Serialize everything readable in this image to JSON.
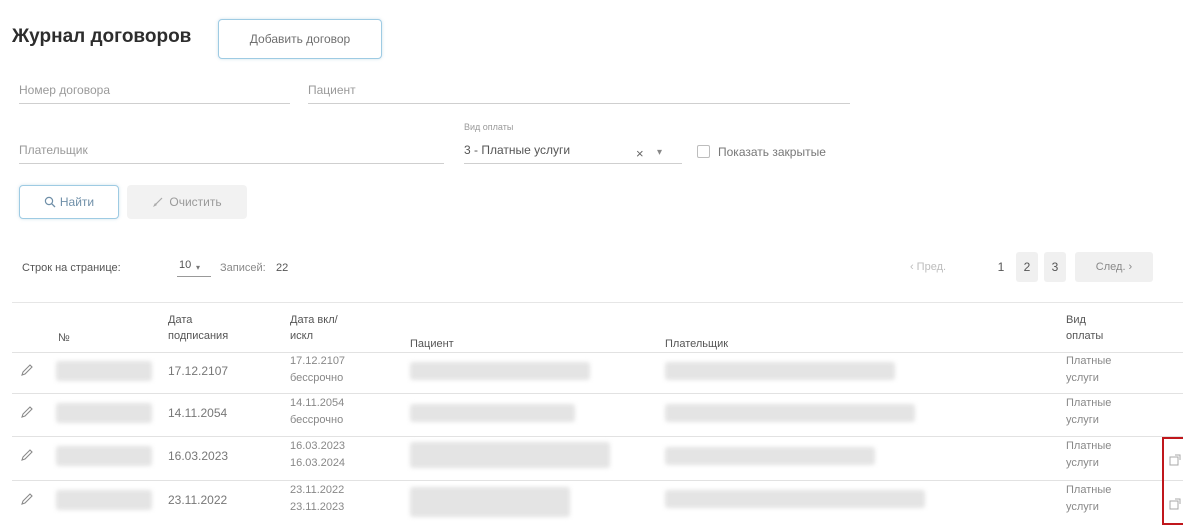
{
  "header": {
    "title": "Журнал договоров",
    "add_button_label": "Добавить договор"
  },
  "filters": {
    "contract_number_placeholder": "Номер договора",
    "patient_placeholder": "Пациент",
    "payer_placeholder": "Плательщик",
    "pay_type_label": "Вид оплаты",
    "pay_type_value": "3 - Платные услуги",
    "clear_symbol": "×",
    "dropdown_symbol": "▾",
    "show_closed_label": "Показать закрытые",
    "find_button_label": "Найти",
    "clear_button_label": "Очистить"
  },
  "pagination": {
    "rows_per_page_label": "Строк на странице:",
    "rows_per_page_value": "10",
    "records_label": "Записей:",
    "records_value": "22",
    "prev_label": "‹ Пред.",
    "pages": [
      "1",
      "2",
      "3"
    ],
    "next_label": "След. ›"
  },
  "table": {
    "headers": {
      "number": "№",
      "sign_date_1": "Дата",
      "sign_date_2": "подписания",
      "incl_date_1": "Дата вкл/",
      "incl_date_2": "искл",
      "patient": "Пациент",
      "payer": "Плательщик",
      "pay_type_1": "Вид",
      "pay_type_2": "оплаты"
    },
    "rows": [
      {
        "sign_date": "17.12.2107",
        "incl": "17.12.2107",
        "excl": "бессрочно",
        "pay_type_1": "Платные",
        "pay_type_2": "услуги"
      },
      {
        "sign_date": "14.11.2054",
        "incl": "14.11.2054",
        "excl": "бессрочно",
        "pay_type_1": "Платные",
        "pay_type_2": "услуги"
      },
      {
        "sign_date": "16.03.2023",
        "incl": "16.03.2023",
        "excl": "16.03.2024",
        "pay_type_1": "Платные",
        "pay_type_2": "услуги"
      },
      {
        "sign_date": "23.11.2022",
        "incl": "23.11.2022",
        "excl": "23.11.2023",
        "pay_type_1": "Платные",
        "pay_type_2": "услуги"
      }
    ]
  },
  "icons": {
    "edit": "pencil-icon",
    "search": "search-icon",
    "clear": "broom-icon",
    "copy": "external-link-icon"
  },
  "colors": {
    "accent_border": "#9ecbe3",
    "highlight_red": "#c0171c"
  }
}
